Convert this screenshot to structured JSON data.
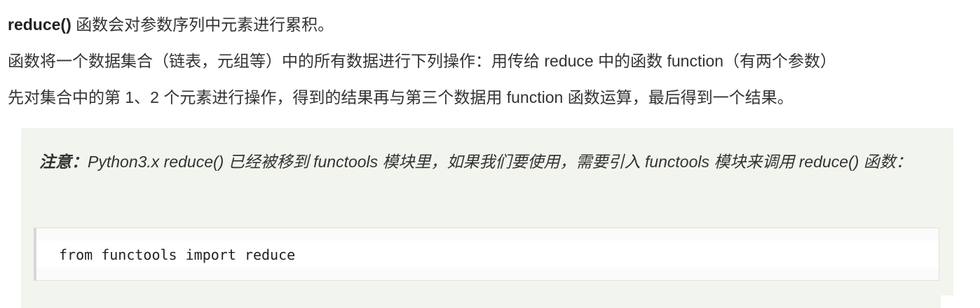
{
  "paragraph1": {
    "keyword": "reduce()",
    "text": " 函数会对参数序列中元素进行累积。"
  },
  "paragraph2": {
    "text": "函数将一个数据集合（链表，元组等）中的所有数据进行下列操作：用传给 reduce 中的函数 function（有两个参数）"
  },
  "paragraph3": {
    "text": "先对集合中的第 1、2 个元素进行操作，得到的结果再与第三个数据用 function 函数运算，最后得到一个结果。"
  },
  "note": {
    "label": "注意：",
    "text": "Python3.x reduce() 已经被移到 functools 模块里，如果我们要使用，需要引入 functools 模块来调用 reduce() 函数："
  },
  "code": {
    "line": "from functools import reduce"
  }
}
